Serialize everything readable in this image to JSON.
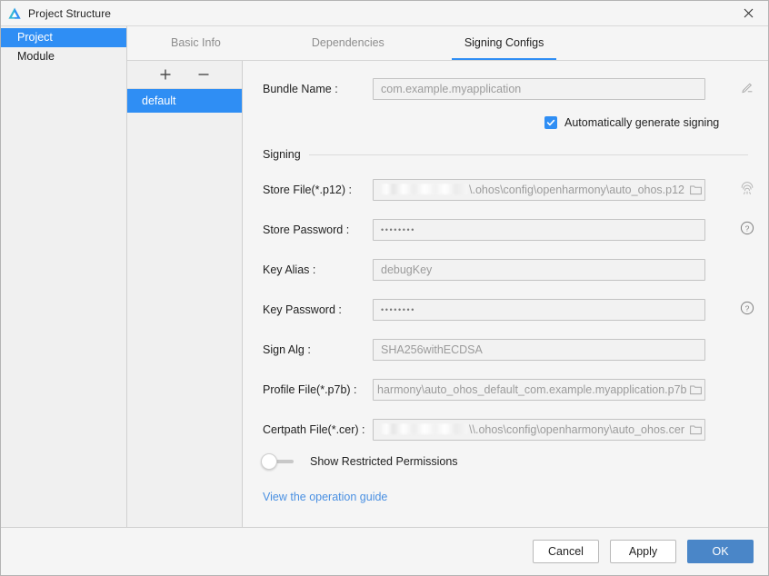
{
  "window": {
    "title": "Project Structure",
    "app_icon": "deveco-logo-icon",
    "close_icon": "close-icon"
  },
  "tree": {
    "items": [
      {
        "label": "Project",
        "selected": true
      },
      {
        "label": "Module",
        "selected": false
      }
    ]
  },
  "tabs": [
    {
      "label": "Basic Info",
      "active": false
    },
    {
      "label": "Dependencies",
      "active": false
    },
    {
      "label": "Signing Configs",
      "active": true
    }
  ],
  "config_list": {
    "add_label": "+",
    "remove_label": "−",
    "items": [
      {
        "label": "default",
        "selected": true
      }
    ]
  },
  "form": {
    "bundle_name": {
      "label": "Bundle Name :",
      "value": "com.example.myapplication",
      "edit_icon": "pencil-icon"
    },
    "auto_generate": {
      "label": "Automatically generate signing",
      "checked": true
    },
    "group_title": "Signing",
    "store_file": {
      "label": "Store File(*.p12) :",
      "value": "\\.ohos\\config\\openharmony\\auto_ohos.p12",
      "redacted": true,
      "folder_icon": "folder-icon",
      "side_icon": "fingerprint-icon"
    },
    "store_password": {
      "label": "Store Password :",
      "value": "••••••••",
      "help_icon": "help-circle-icon"
    },
    "key_alias": {
      "label": "Key Alias :",
      "value": "debugKey"
    },
    "key_password": {
      "label": "Key Password :",
      "value": "••••••••",
      "help_icon": "help-circle-icon"
    },
    "sign_alg": {
      "label": "Sign Alg :",
      "value": "SHA256withECDSA"
    },
    "profile_file": {
      "label": "Profile File(*.p7b) :",
      "value": "harmony\\auto_ohos_default_com.example.myapplication.p7b",
      "folder_icon": "folder-icon"
    },
    "certpath_file": {
      "label": "Certpath File(*.cer) :",
      "value": "\\\\.ohos\\config\\openharmony\\auto_ohos.cer",
      "redacted": true,
      "folder_icon": "folder-icon"
    },
    "show_restricted": {
      "label": "Show Restricted Permissions",
      "enabled": false
    },
    "guide_link": "View the operation guide"
  },
  "footer": {
    "cancel": "Cancel",
    "apply": "Apply",
    "ok": "OK"
  },
  "colors": {
    "accent_blue": "#2f8ef4",
    "primary_button": "#4a86c8",
    "link_blue": "#4a90e2",
    "window_bg": "#f5f5f5",
    "panel_bg": "#f0f0f0",
    "field_bg": "#f2f2f2"
  }
}
